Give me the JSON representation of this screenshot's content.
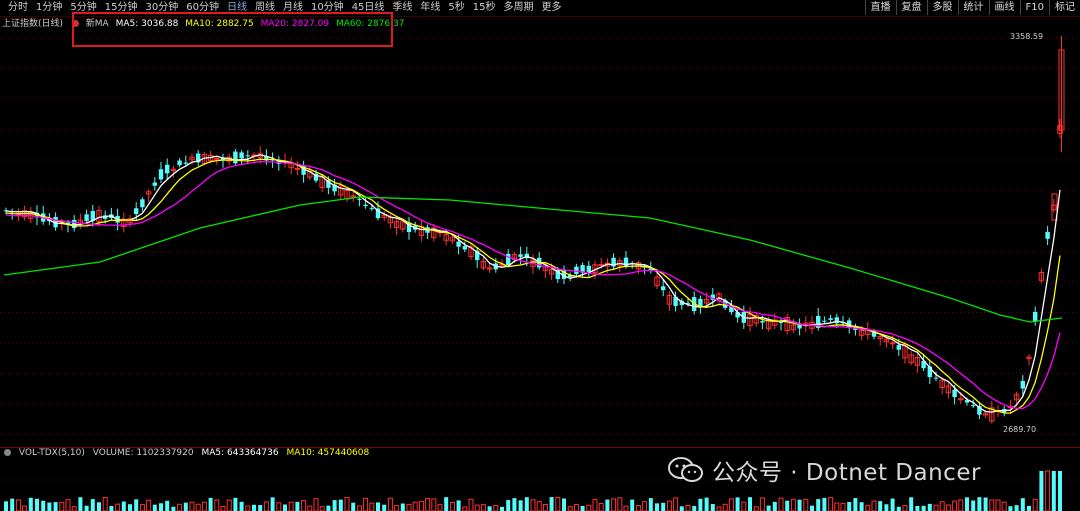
{
  "toolbar": {
    "periods": [
      "分时",
      "1分钟",
      "5分钟",
      "15分钟",
      "30分钟",
      "60分钟",
      "日线",
      "周线",
      "月线",
      "10分钟",
      "45日线",
      "季线",
      "年线",
      "5秒",
      "15秒",
      "多周期",
      "更多"
    ],
    "active_period": "日线",
    "right_buttons": [
      "直播",
      "复盘",
      "多股",
      "统计",
      "画线",
      "F10",
      "标记"
    ]
  },
  "chart_header": {
    "title": "上证指数(日线)",
    "indicator": "新MA",
    "ma5": "MA5: 3036.88",
    "ma10": "MA10: 2882.75",
    "ma20": "MA20: 2827.09",
    "ma60": "MA60: 2876.37"
  },
  "price_labels": {
    "high": "3358.59",
    "low": "2689.70"
  },
  "volume_header": {
    "name": "VOL-TDX(5,10)",
    "volume": "VOLUME: 1102337920",
    "ma5": "MA5: 643364736",
    "ma10": "MA10: 457440608"
  },
  "watermark": {
    "text": "公众号 · Dotnet Dancer",
    "icon": "wechat-icon"
  },
  "colors": {
    "up": "#ff3030",
    "down": "#54fcfc",
    "ma5": "#ffffff",
    "ma10": "#ffff00",
    "ma20": "#ff00ff",
    "ma60": "#00e600",
    "highlight_box": "#e0191c"
  }
}
